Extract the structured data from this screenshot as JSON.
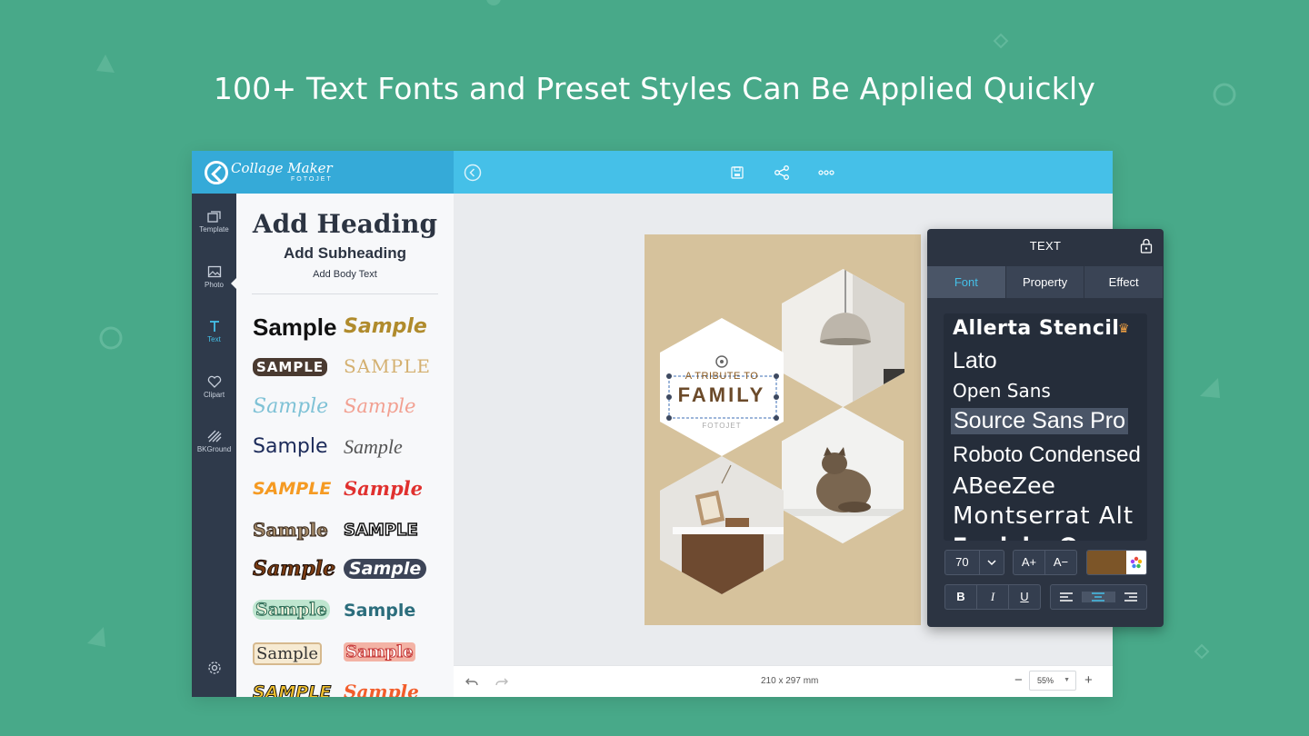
{
  "headline": "100+ Text Fonts and Preset Styles Can Be Applied Quickly",
  "app": {
    "logo_main": "Collage Maker",
    "logo_sub": "FOTOJET"
  },
  "sidebar": {
    "items": [
      {
        "label": "Template",
        "icon": "template-icon"
      },
      {
        "label": "Photo",
        "icon": "photo-icon"
      },
      {
        "label": "Text",
        "icon": "text-icon"
      },
      {
        "label": "Clipart",
        "icon": "heart-icon"
      },
      {
        "label": "BKGround",
        "icon": "background-icon"
      }
    ]
  },
  "text_panel_left": {
    "heading": "Add Heading",
    "subheading": "Add Subheading",
    "body": "Add Body Text",
    "samples": [
      "Sample",
      "Sample",
      "SAMPLE",
      "SAMPLE",
      "Sample",
      "Sample",
      "Sample",
      "Sample",
      "SAMPLE",
      "Sample",
      "Sample",
      "SAMPLE",
      "Sample",
      "Sample",
      "Sample",
      "Sample",
      "Sample",
      "Sample",
      "SAMPLE",
      "Sample"
    ]
  },
  "poster": {
    "line1": "A TRIBUTE TO",
    "line2": "FAMILY",
    "brand": "FOTOJET"
  },
  "canvas": {
    "size_label": "210 x 297 mm",
    "zoom": "55%",
    "zoom_out": "−",
    "zoom_in": "+"
  },
  "text_props": {
    "title": "TEXT",
    "tabs": [
      "Font",
      "Property",
      "Effect"
    ],
    "fonts": [
      "Allerta Stencil",
      "Lato",
      "Open Sans",
      "Source Sans Pro",
      "Roboto Condensed",
      "ABeeZee",
      "Montserrat Alt",
      "Fredoka One"
    ],
    "font_size": "70",
    "size_up": "A+",
    "size_down": "A−",
    "color": "#7c5528",
    "style_buttons": [
      "B",
      "I",
      "U"
    ]
  },
  "colors": {
    "background": "#48a989",
    "topbar": "#45c0e8",
    "accent": "#45c0e8",
    "rail": "#2f3a4b"
  }
}
